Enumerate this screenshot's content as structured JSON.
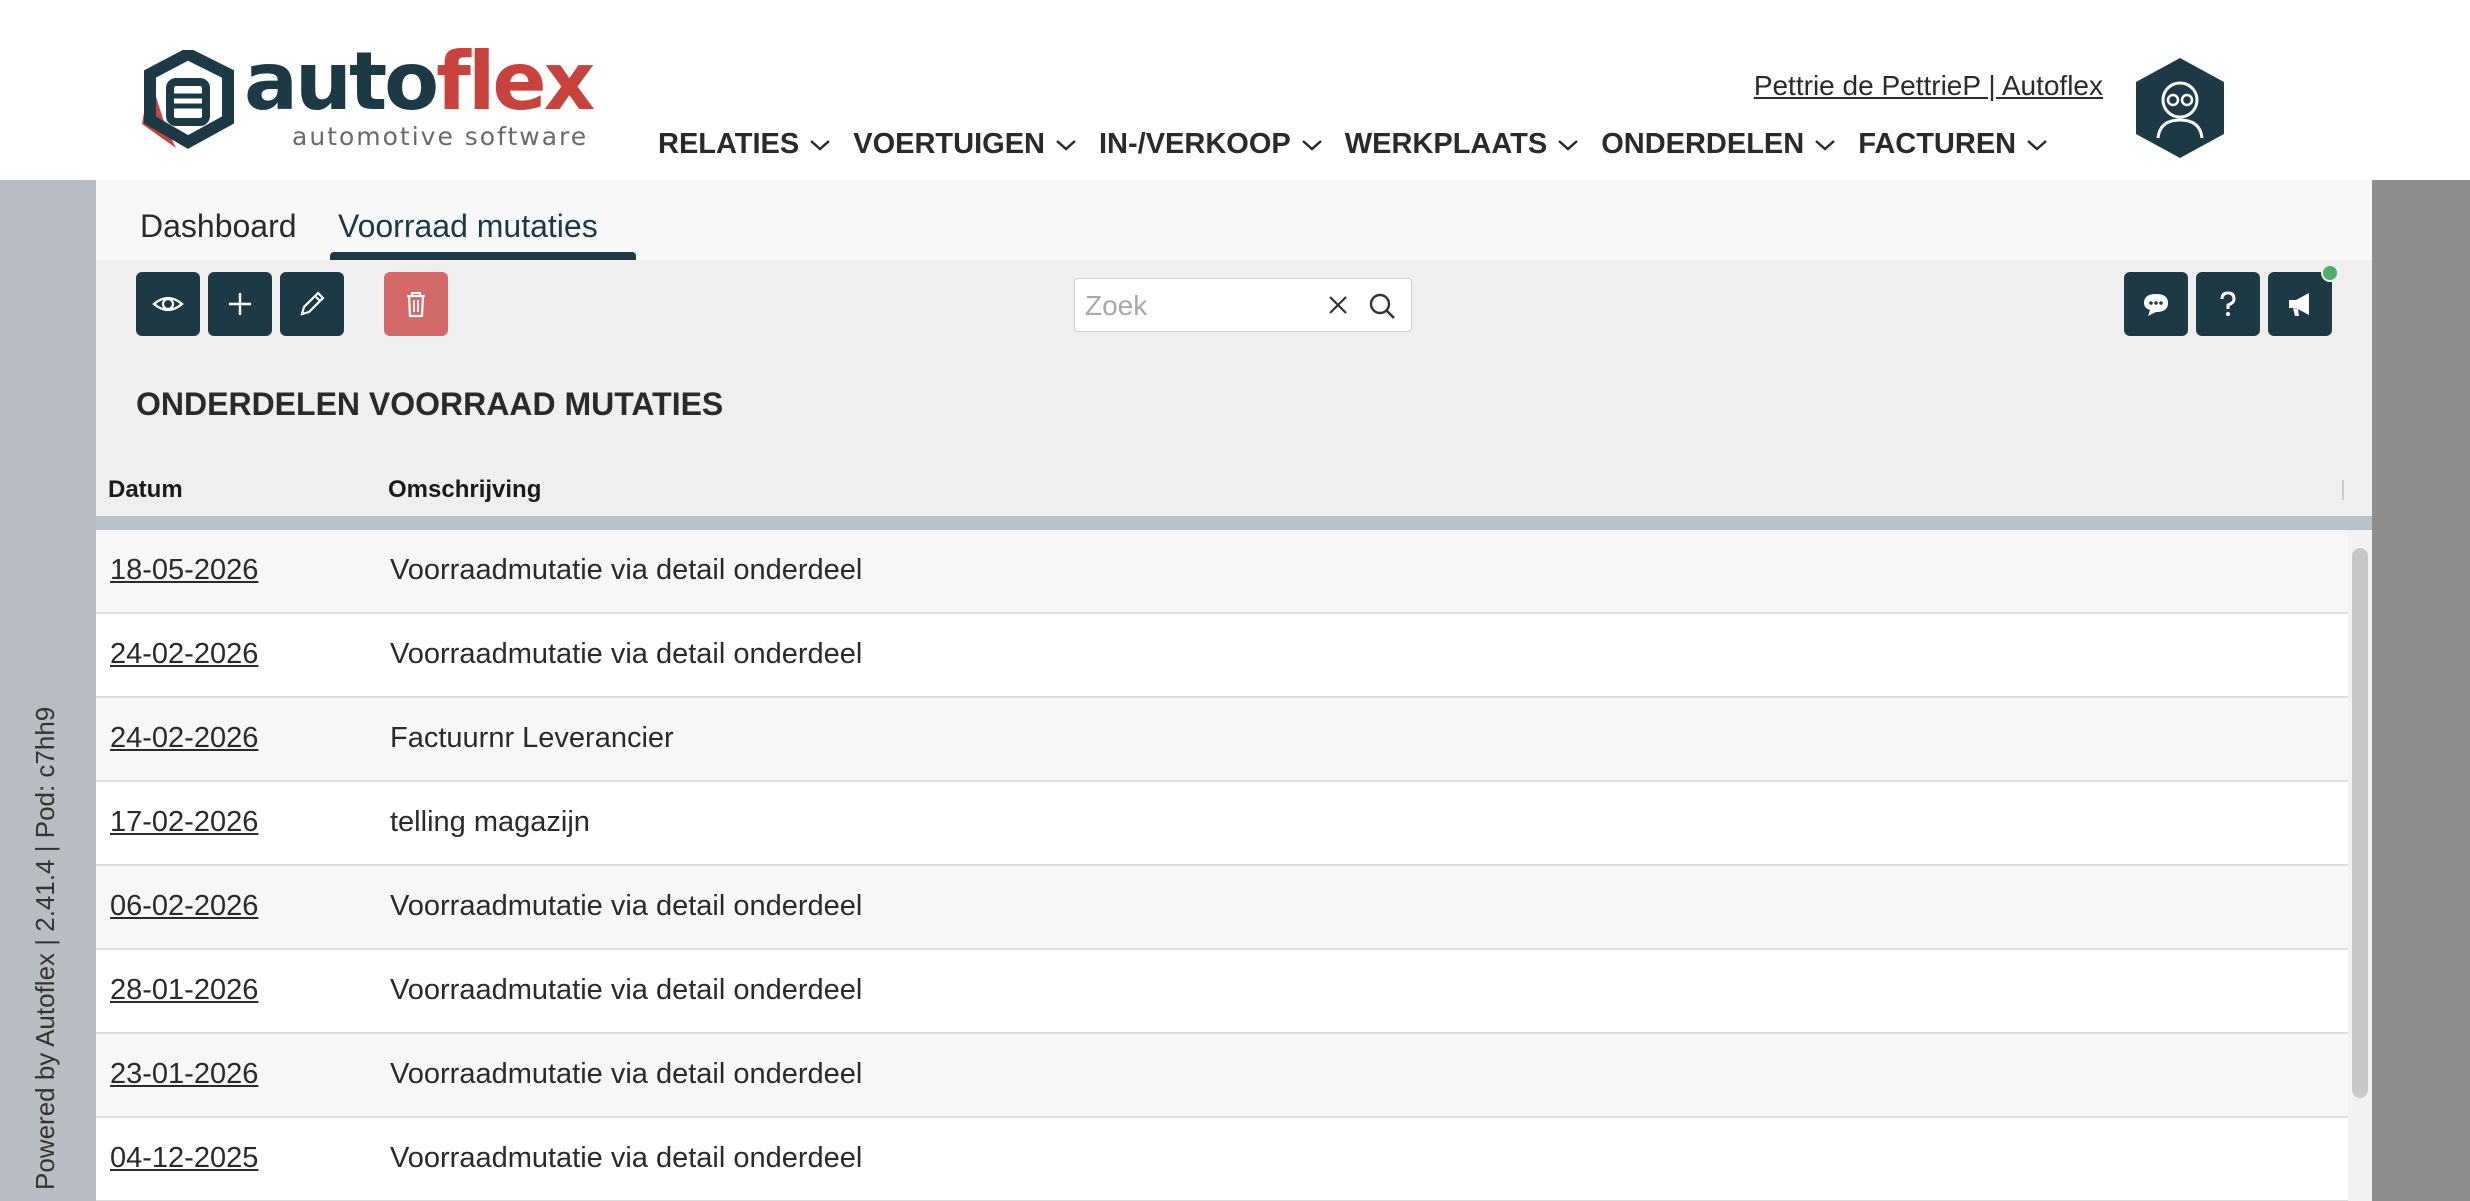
{
  "brand": {
    "logo_word_a": "auto",
    "logo_word_b": "flex",
    "tagline": "automotive software"
  },
  "header": {
    "user_link": "Pettrie de PettrieP | Autoflex",
    "nav": [
      {
        "label": "RELATIES"
      },
      {
        "label": "VOERTUIGEN"
      },
      {
        "label": "IN-/VERKOOP"
      },
      {
        "label": "WERKPLAATS"
      },
      {
        "label": "ONDERDELEN"
      },
      {
        "label": "FACTUREN"
      }
    ]
  },
  "sidebar": {
    "version_text": "Powered by Autoflex | 2.41.4 | Pod: c7hh9"
  },
  "tabs": [
    {
      "label": "Dashboard",
      "active": false
    },
    {
      "label": "Voorraad mutaties",
      "active": true
    }
  ],
  "toolbar": {
    "search_placeholder": "Zoek",
    "search_value": "",
    "buttons": [
      "view-icon",
      "plus-icon",
      "pencil-icon",
      "trash-icon"
    ],
    "right_buttons": [
      "chat-icon",
      "question-icon",
      "megaphone-icon"
    ]
  },
  "page": {
    "title": "ONDERDELEN VOORRAAD MUTATIES"
  },
  "table": {
    "columns": [
      "Datum",
      "Omschrijving"
    ],
    "rows": [
      {
        "date": "18-05-2026",
        "description": "Voorraadmutatie via detail onderdeel"
      },
      {
        "date": "24-02-2026",
        "description": "Voorraadmutatie via detail onderdeel"
      },
      {
        "date": "24-02-2026",
        "description": "Factuurnr Leverancier"
      },
      {
        "date": "17-02-2026",
        "description": "telling magazijn"
      },
      {
        "date": "06-02-2026",
        "description": "Voorraadmutatie via detail onderdeel"
      },
      {
        "date": "28-01-2026",
        "description": "Voorraadmutatie via detail onderdeel"
      },
      {
        "date": "23-01-2026",
        "description": "Voorraadmutatie via detail onderdeel"
      },
      {
        "date": "04-12-2025",
        "description": "Voorraadmutatie via detail onderdeel"
      }
    ]
  },
  "colors": {
    "primary": "#1b3a46",
    "brand_red": "#c9423b",
    "delete": "#d36a68",
    "notify": "#4caf6a"
  }
}
